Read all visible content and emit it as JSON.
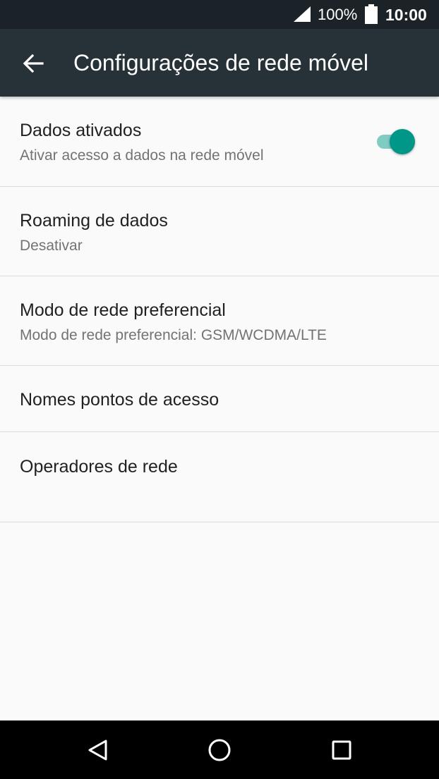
{
  "status_bar": {
    "battery_percent": "100%",
    "time": "10:00",
    "icons": [
      "signal-icon",
      "battery-icon"
    ]
  },
  "app_bar": {
    "title": "Configurações de rede móvel",
    "back_icon": "arrow-left-icon"
  },
  "settings": {
    "items": [
      {
        "label": "Dados ativados",
        "summary": "Ativar acesso a dados na rede móvel",
        "toggle_on": true
      },
      {
        "label": "Roaming de dados",
        "summary": "Desativar"
      },
      {
        "label": "Modo de rede preferencial",
        "summary": "Modo de rede preferencial: GSM/WCDMA/LTE"
      },
      {
        "label": "Nomes pontos de acesso"
      },
      {
        "label": "Operadores de rede"
      }
    ]
  },
  "nav_bar": {
    "icons": [
      "back-triangle-icon",
      "home-circle-icon",
      "recents-square-icon"
    ]
  },
  "colors": {
    "status_bar": "#1b2328",
    "app_bar": "#263238",
    "background": "#fafafa",
    "accent": "#009688",
    "accent_track": "#80cbc4",
    "divider": "#dcdcdc"
  }
}
